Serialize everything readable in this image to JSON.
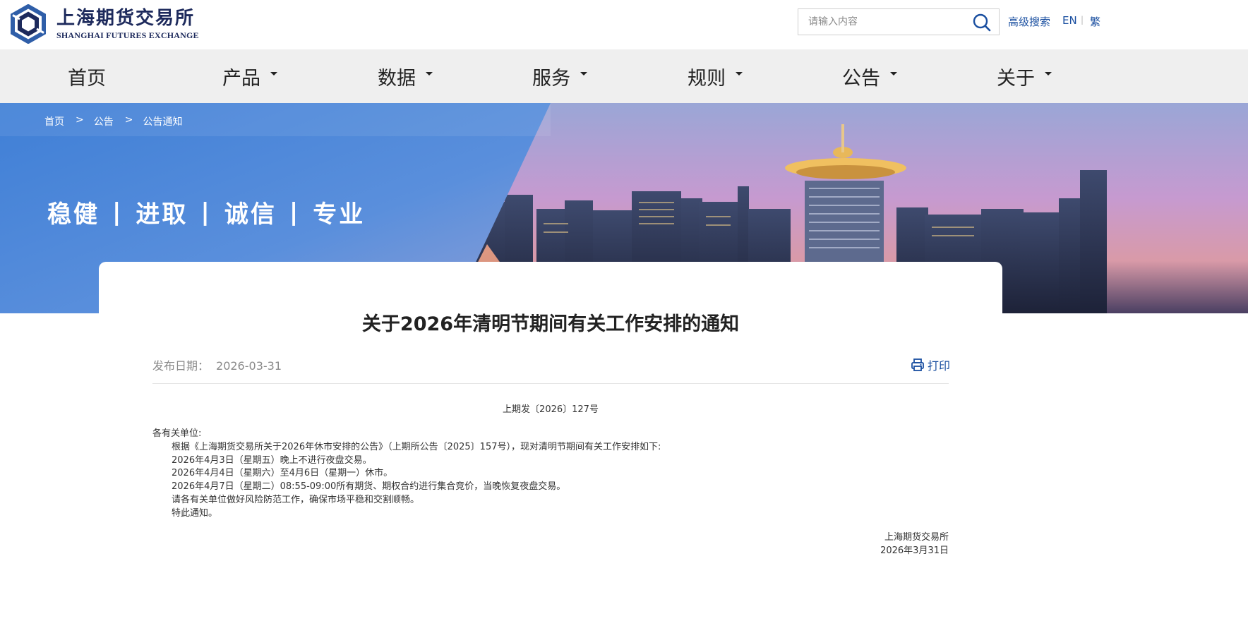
{
  "header": {
    "logo_cn": "上海期货交易所",
    "logo_en": "SHANGHAI FUTURES EXCHANGE",
    "search_placeholder": "请输入内容",
    "advanced_search": "高级搜索",
    "lang_en": "EN",
    "lang_sep": "|",
    "lang_traditional": "繁"
  },
  "nav": {
    "items": [
      {
        "label": "首页"
      },
      {
        "label": "产品"
      },
      {
        "label": "数据"
      },
      {
        "label": "服务"
      },
      {
        "label": "规则"
      },
      {
        "label": "公告"
      },
      {
        "label": "关于"
      }
    ]
  },
  "breadcrumb": {
    "items": [
      "首页",
      "公告",
      "公告通知"
    ],
    "separator": ">"
  },
  "banner": {
    "slogan": [
      "稳健",
      "进取",
      "诚信",
      "专业"
    ],
    "slogan_sep": "|"
  },
  "article": {
    "title": "关于2026年清明节期间有关工作安排的通知",
    "pub_label": "发布日期：",
    "pub_date": "2026-03-31",
    "print_label": "打印",
    "doc_no": "上期发〔2026〕127号",
    "salutation": "各有关单位:",
    "paragraphs": [
      "根据《上海期货交易所关于2026年休市安排的公告》（上期所公告〔2025〕157号），现对清明节期间有关工作安排如下:",
      "2026年4月3日（星期五）晚上不进行夜盘交易。",
      "2026年4月4日（星期六）至4月6日（星期一）休市。",
      "2026年4月7日（星期二）08:55-09:00所有期货、期权合约进行集合竞价，当晚恢复夜盘交易。",
      "请各有关单位做好风险防范工作，确保市场平稳和交割顺畅。",
      "特此通知。"
    ],
    "signature_org": "上海期货交易所",
    "signature_date": "2026年3月31日"
  },
  "colors": {
    "brand_navy": "#1d2a5c",
    "link_blue": "#1a4fa0",
    "nav_bg": "#efefef"
  }
}
